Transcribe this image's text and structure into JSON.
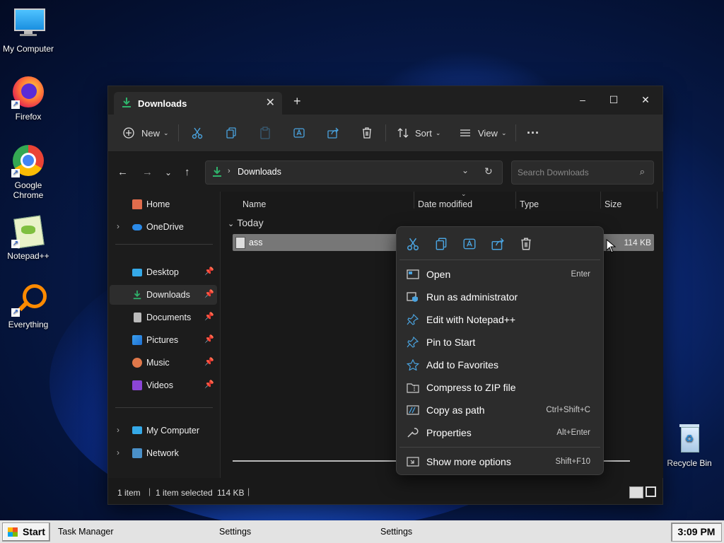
{
  "desktop": {
    "icons": [
      {
        "label": "My Computer"
      },
      {
        "label": "Firefox"
      },
      {
        "label": "Google Chrome"
      },
      {
        "label": "Notepad++"
      },
      {
        "label": "Everything"
      },
      {
        "label": "Recycle Bin"
      }
    ]
  },
  "window": {
    "tab_title": "Downloads",
    "toolbar": {
      "new_label": "New",
      "sort_label": "Sort",
      "view_label": "View"
    },
    "address": {
      "path": "Downloads",
      "search_placeholder": "Search Downloads"
    },
    "sidebar": {
      "items": [
        {
          "label": "Home"
        },
        {
          "label": "OneDrive"
        },
        {
          "label": "Desktop"
        },
        {
          "label": "Downloads"
        },
        {
          "label": "Documents"
        },
        {
          "label": "Pictures"
        },
        {
          "label": "Music"
        },
        {
          "label": "Videos"
        },
        {
          "label": "My Computer"
        },
        {
          "label": "Network"
        }
      ]
    },
    "columns": [
      "Name",
      "Date modified",
      "Type",
      "Size"
    ],
    "group_label": "Today",
    "file": {
      "name": "ass",
      "size": "114 KB"
    },
    "status": {
      "count": "1 item",
      "selected": "1 item selected",
      "size": "114 KB"
    }
  },
  "context_menu": {
    "items": [
      {
        "label": "Open",
        "shortcut": "Enter"
      },
      {
        "label": "Run as administrator",
        "shortcut": ""
      },
      {
        "label": "Edit with Notepad++",
        "shortcut": ""
      },
      {
        "label": "Pin to Start",
        "shortcut": ""
      },
      {
        "label": "Add to Favorites",
        "shortcut": ""
      },
      {
        "label": "Compress to ZIP file",
        "shortcut": ""
      },
      {
        "label": "Copy as path",
        "shortcut": "Ctrl+Shift+C"
      },
      {
        "label": "Properties",
        "shortcut": "Alt+Enter"
      }
    ],
    "more": {
      "label": "Show more options",
      "shortcut": "Shift+F10"
    }
  },
  "taskbar": {
    "start_label": "Start",
    "tasks": [
      "Task Manager",
      "Settings",
      "Settings"
    ],
    "clock": "3:09 PM"
  },
  "colors": {
    "accent_green": "#2fb36b",
    "taskbar_bg": "#e3e3e3",
    "menu_bg": "#2c2c2c"
  }
}
